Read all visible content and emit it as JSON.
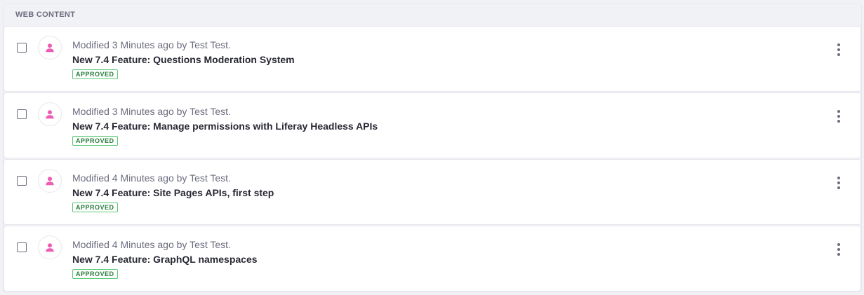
{
  "section": {
    "title": "WEB CONTENT"
  },
  "colors": {
    "avatar_icon": "#ef5cb4",
    "approved_text": "#287d3c",
    "approved_border": "#5aca75"
  },
  "icons": {
    "avatar": "user-icon",
    "actions": "vertical-ellipsis-icon"
  },
  "items": [
    {
      "modified": "Modified 3 Minutes ago by Test Test.",
      "title": "New 7.4 Feature: Questions Moderation System",
      "status": "APPROVED"
    },
    {
      "modified": "Modified 3 Minutes ago by Test Test.",
      "title": "New 7.4 Feature: Manage permissions with Liferay Headless APIs",
      "status": "APPROVED"
    },
    {
      "modified": "Modified 4 Minutes ago by Test Test.",
      "title": "New 7.4 Feature: Site Pages APIs, first step",
      "status": "APPROVED"
    },
    {
      "modified": "Modified 4 Minutes ago by Test Test.",
      "title": "New 7.4 Feature: GraphQL namespaces",
      "status": "APPROVED"
    }
  ]
}
